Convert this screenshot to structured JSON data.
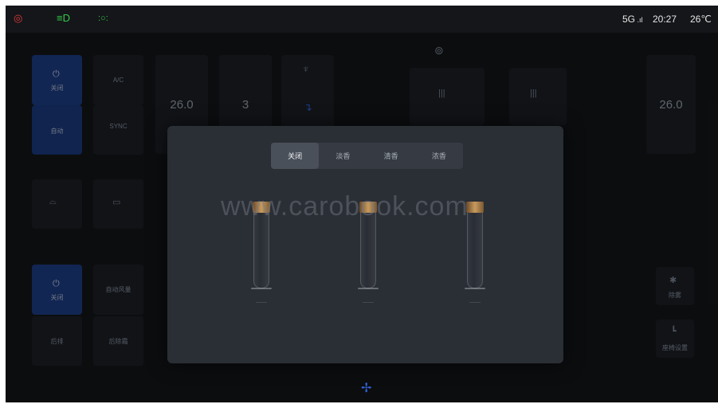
{
  "status": {
    "left_icons": [
      "fault-warning-icon",
      "headlight-icon",
      "position-light-icon"
    ],
    "network": "5G",
    "time": "20:27",
    "temperature": "26℃"
  },
  "left_panel": {
    "power_label": "关闭",
    "auto_label": "自动",
    "ac_label": "A/C",
    "sync_label": "SYNC",
    "rear_power_label": "关闭",
    "rear_label1": "后排",
    "rear_label2": "自动风量",
    "rear_label3": "后除霜"
  },
  "climate": {
    "left_temp": "26.0",
    "fan_level": "3",
    "right_temp": "26.0"
  },
  "right_panel": {
    "label1": "除雾",
    "label2": "座椅设置"
  },
  "fragrance_modal": {
    "tabs": [
      {
        "label": "关闭",
        "active": true
      },
      {
        "label": "淡香",
        "active": false
      },
      {
        "label": "清香",
        "active": false
      },
      {
        "label": "浓香",
        "active": false
      }
    ]
  },
  "watermark": "www.carobook.com",
  "colors": {
    "screen_bg": "#141619",
    "modal_bg": "#2a2e35",
    "accent_blue": "#1d3e86",
    "fault_red": "#e23a3a",
    "light_green": "#35c84a"
  }
}
